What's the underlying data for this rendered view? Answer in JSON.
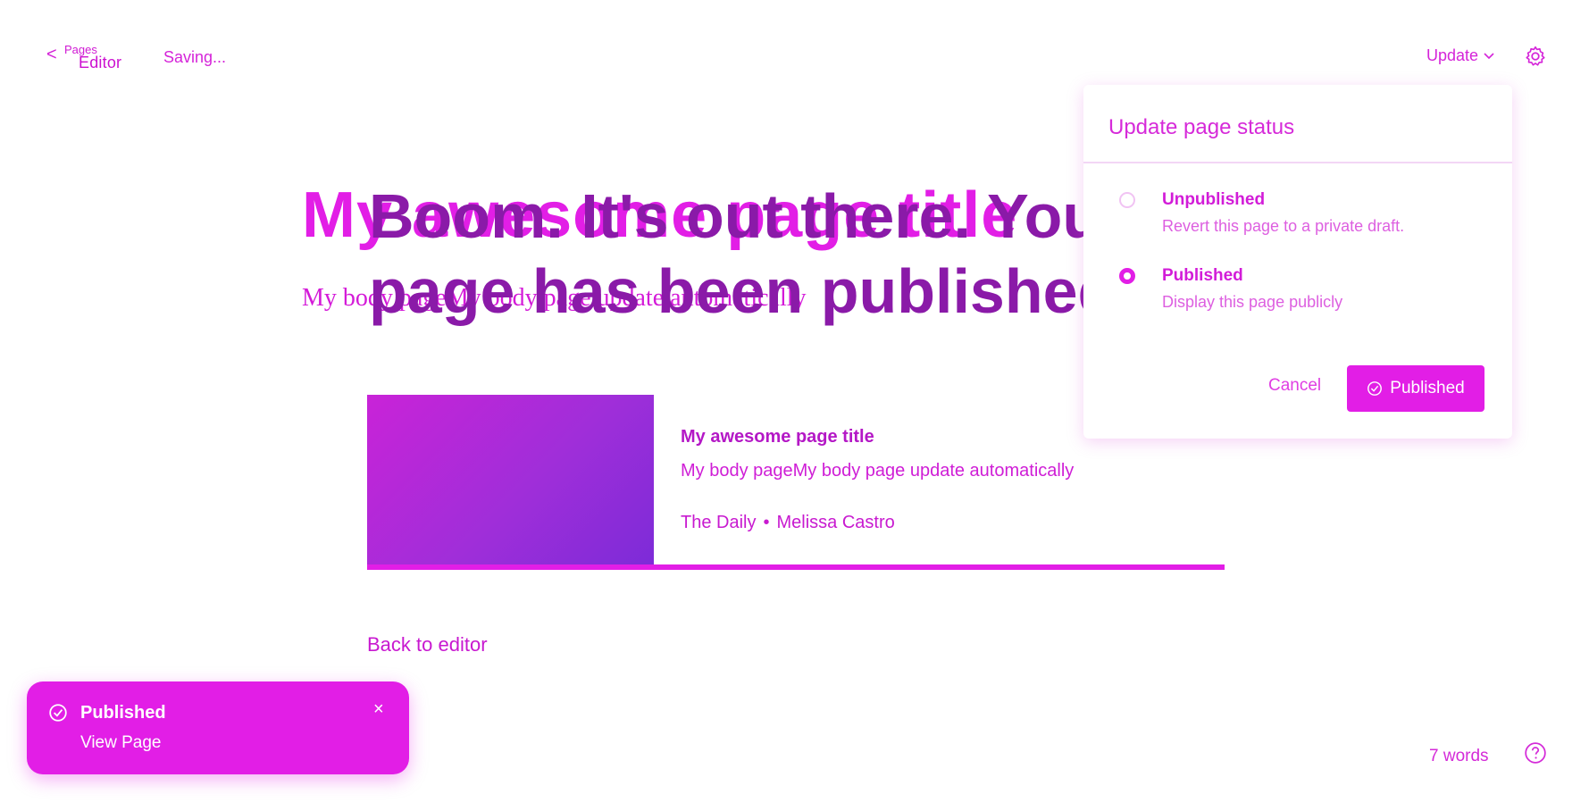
{
  "topbar": {
    "back_chevron": "<",
    "back_posts": "Pages",
    "back_label": "Editor",
    "status": "Saving...",
    "update_label": "Update",
    "settings_icon": "gear-icon"
  },
  "editor": {
    "title": "My awesome page title",
    "body": "My body pageMy body page update automatically"
  },
  "published": {
    "heading": "Boom. It's out there. Your page has been published.",
    "card": {
      "title": "My awesome page title",
      "body": "My body pageMy body page update automatically",
      "publication": "The Daily",
      "separator": "•",
      "author": "Melissa Castro"
    },
    "back_to_editor": "Back to editor"
  },
  "status_panel": {
    "title": "Update page status",
    "options": [
      {
        "label": "Unpublished",
        "description": "Revert this page to a private draft.",
        "checked": false
      },
      {
        "label": "Published",
        "description": "Display this page publicly",
        "checked": true
      }
    ],
    "cancel_label": "Cancel",
    "confirm_label": "Published"
  },
  "toast": {
    "title": "Published",
    "link": "View Page",
    "close": "×"
  },
  "footer": {
    "word_count": "7 words",
    "help_icon": "help-icon"
  },
  "colors": {
    "accent": "#e21ee6",
    "heading_dark": "#8a1aa8"
  }
}
